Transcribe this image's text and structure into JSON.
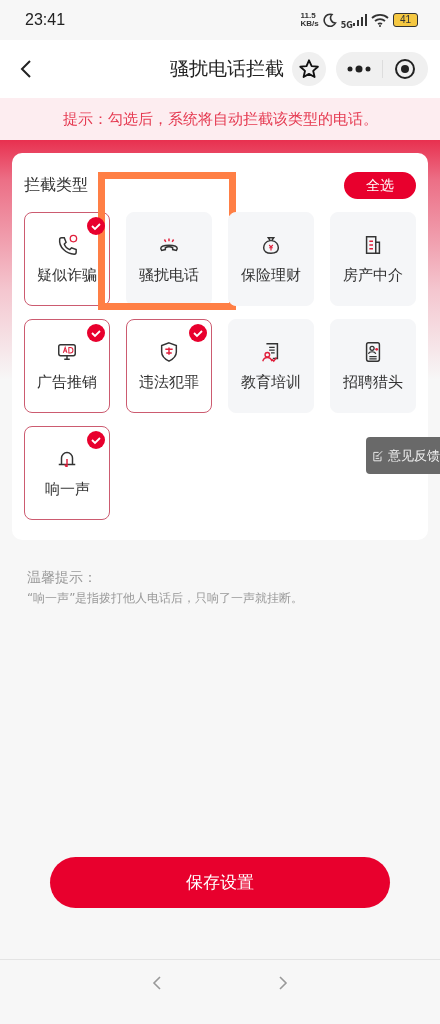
{
  "status_bar": {
    "time": "23:41",
    "net_speed": "11.5",
    "net_unit": "KB/s",
    "network": "5G",
    "battery": "41"
  },
  "nav": {
    "title": "骚扰电话拦截"
  },
  "notice": "提示：勾选后，系统将自动拦截该类型的电话。",
  "card": {
    "title": "拦截类型",
    "select_all": "全选",
    "items": [
      {
        "label": "疑似诈骗",
        "checked": true,
        "highlighted": false
      },
      {
        "label": "骚扰电话",
        "checked": false,
        "highlighted": true
      },
      {
        "label": "保险理财",
        "checked": false,
        "highlighted": false
      },
      {
        "label": "房产中介",
        "checked": false,
        "highlighted": false
      },
      {
        "label": "广告推销",
        "checked": true,
        "highlighted": false
      },
      {
        "label": "违法犯罪",
        "checked": true,
        "highlighted": false
      },
      {
        "label": "教育培训",
        "checked": false,
        "highlighted": false
      },
      {
        "label": "招聘猎头",
        "checked": false,
        "highlighted": false
      },
      {
        "label": "响一声",
        "checked": true,
        "highlighted": false
      }
    ]
  },
  "feedback": "意见反馈",
  "hint": {
    "title": "温馨提示：",
    "text": "“响一声”是指拨打他人电话后，只响了一声就挂断。"
  },
  "save_button": "保存设置"
}
